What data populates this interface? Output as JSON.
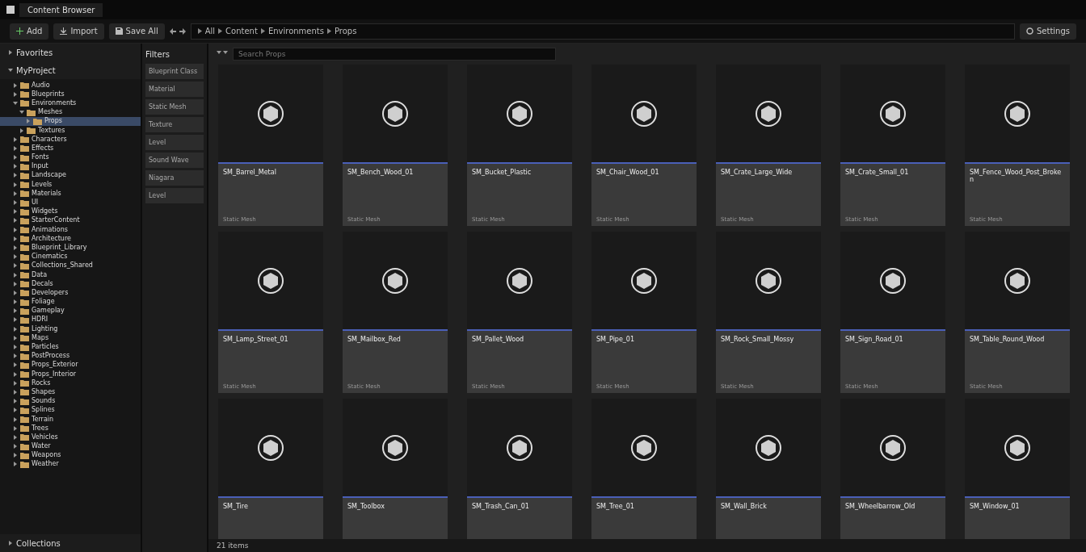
{
  "window": {
    "title": "Content Browser"
  },
  "toolbar": {
    "buttons": [
      {
        "kind": "add",
        "label": "Add"
      },
      {
        "kind": "import",
        "label": "Import"
      },
      {
        "kind": "save",
        "label": "Save All"
      }
    ],
    "path": [
      "All",
      "Content",
      "Environments",
      "Props"
    ],
    "settings": "Settings"
  },
  "favorites": {
    "label": "Favorites"
  },
  "tree": {
    "label": "MyProject",
    "items": [
      {
        "name": "Audio",
        "expanded": false,
        "selected": false
      },
      {
        "name": "Blueprints",
        "expanded": false,
        "selected": false
      },
      {
        "name": "Environments",
        "expanded": true,
        "selected": false,
        "children": [
          {
            "name": "Meshes",
            "expanded": true,
            "selected": false,
            "children": [
              {
                "name": "Props",
                "expanded": false,
                "selected": true
              }
            ]
          },
          {
            "name": "Textures",
            "expanded": false,
            "selected": false
          }
        ]
      },
      {
        "name": "Characters",
        "expanded": false,
        "selected": false
      },
      {
        "name": "Effects",
        "expanded": false,
        "selected": false
      },
      {
        "name": "Fonts",
        "expanded": false,
        "selected": false
      },
      {
        "name": "Input",
        "expanded": false,
        "selected": false
      },
      {
        "name": "Landscape",
        "expanded": false,
        "selected": false
      },
      {
        "name": "Levels",
        "expanded": false,
        "selected": false
      },
      {
        "name": "Materials",
        "expanded": false,
        "selected": false
      },
      {
        "name": "UI",
        "expanded": false,
        "selected": false
      },
      {
        "name": "Widgets",
        "expanded": false,
        "selected": false
      },
      {
        "name": "StarterContent",
        "expanded": false,
        "selected": false
      },
      {
        "name": "Animations",
        "expanded": false,
        "selected": false
      },
      {
        "name": "Architecture",
        "expanded": false,
        "selected": false
      },
      {
        "name": "Blueprint_Library",
        "expanded": false,
        "selected": false
      },
      {
        "name": "Cinematics",
        "expanded": false,
        "selected": false
      },
      {
        "name": "Collections_Shared",
        "expanded": false,
        "selected": false
      },
      {
        "name": "Data",
        "expanded": false,
        "selected": false
      },
      {
        "name": "Decals",
        "expanded": false,
        "selected": false
      },
      {
        "name": "Developers",
        "expanded": false,
        "selected": false
      },
      {
        "name": "Foliage",
        "expanded": false,
        "selected": false
      },
      {
        "name": "Gameplay",
        "expanded": false,
        "selected": false
      },
      {
        "name": "HDRI",
        "expanded": false,
        "selected": false
      },
      {
        "name": "Lighting",
        "expanded": false,
        "selected": false
      },
      {
        "name": "Maps",
        "expanded": false,
        "selected": false
      },
      {
        "name": "Particles",
        "expanded": false,
        "selected": false
      },
      {
        "name": "PostProcess",
        "expanded": false,
        "selected": false
      },
      {
        "name": "Props_Exterior",
        "expanded": false,
        "selected": false
      },
      {
        "name": "Props_Interior",
        "expanded": false,
        "selected": false
      },
      {
        "name": "Rocks",
        "expanded": false,
        "selected": false
      },
      {
        "name": "Shapes",
        "expanded": false,
        "selected": false
      },
      {
        "name": "Sounds",
        "expanded": false,
        "selected": false
      },
      {
        "name": "Splines",
        "expanded": false,
        "selected": false
      },
      {
        "name": "Terrain",
        "expanded": false,
        "selected": false
      },
      {
        "name": "Trees",
        "expanded": false,
        "selected": false
      },
      {
        "name": "Vehicles",
        "expanded": false,
        "selected": false
      },
      {
        "name": "Water",
        "expanded": false,
        "selected": false
      },
      {
        "name": "Weapons",
        "expanded": false,
        "selected": false
      },
      {
        "name": "Weather",
        "expanded": false,
        "selected": false
      }
    ]
  },
  "collections": {
    "label": "Collections"
  },
  "filters": {
    "label": "Filters",
    "items": [
      "Blueprint Class",
      "Material",
      "Static Mesh",
      "Texture",
      "Level",
      "Sound Wave",
      "Niagara",
      "Level"
    ]
  },
  "search": {
    "placeholder": "Search Props"
  },
  "assets": [
    {
      "name": "SM_Barrel_Metal",
      "type": "Static Mesh"
    },
    {
      "name": "SM_Bench_Wood_01",
      "type": "Static Mesh"
    },
    {
      "name": "SM_Bucket_Plastic",
      "type": "Static Mesh"
    },
    {
      "name": "SM_Chair_Wood_01",
      "type": "Static Mesh"
    },
    {
      "name": "SM_Crate_Large_Wide",
      "type": "Static Mesh"
    },
    {
      "name": "SM_Crate_Small_01",
      "type": "Static Mesh"
    },
    {
      "name": "SM_Fence_Wood_Post_Broken",
      "type": "Static Mesh"
    },
    {
      "name": "SM_Lamp_Street_01",
      "type": "Static Mesh"
    },
    {
      "name": "SM_Mailbox_Red",
      "type": "Static Mesh"
    },
    {
      "name": "SM_Pallet_Wood",
      "type": "Static Mesh"
    },
    {
      "name": "SM_Pipe_01",
      "type": "Static Mesh"
    },
    {
      "name": "SM_Rock_Small_Mossy",
      "type": "Static Mesh"
    },
    {
      "name": "SM_Sign_Road_01",
      "type": "Static Mesh"
    },
    {
      "name": "SM_Table_Round_Wood",
      "type": "Static Mesh"
    },
    {
      "name": "SM_Tire"
    },
    {
      "name": "SM_Toolbox"
    },
    {
      "name": "SM_Trash_Can_01"
    },
    {
      "name": "SM_Tree_01"
    },
    {
      "name": "SM_Wall_Brick"
    },
    {
      "name": "SM_Wheelbarrow_Old"
    },
    {
      "name": "SM_Window_01"
    }
  ],
  "status_bar": {
    "count": "21 items"
  }
}
